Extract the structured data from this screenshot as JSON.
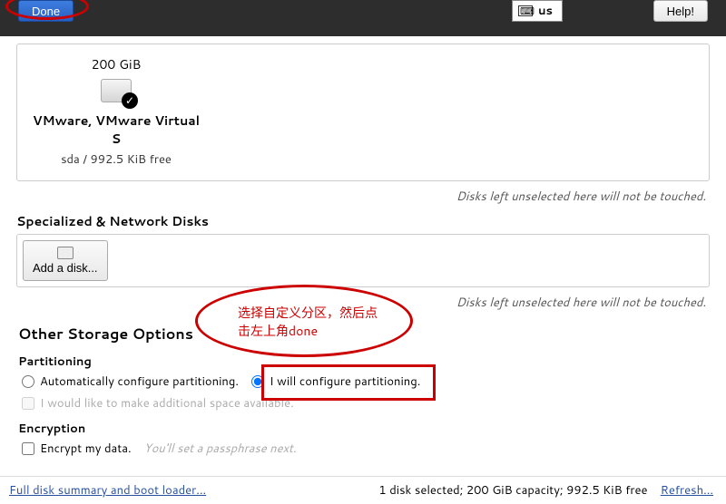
{
  "topbar": {
    "done_label": "Done",
    "lang_code": "us",
    "help_label": "Help!"
  },
  "disks": {
    "size": "200 GiB",
    "name": "VMware, VMware Virtual S",
    "detail": "sda   /   992.5 KiB free"
  },
  "notice_text": "Disks left unselected here will not be touched.",
  "specialized_title": "Specialized & Network Disks",
  "add_disk_label": "Add a disk...",
  "other_title": "Other Storage Options",
  "partitioning": {
    "header": "Partitioning",
    "auto_label": "Automatically configure partitioning.",
    "manual_label": "I will configure partitioning.",
    "additional_label": "I would like to make additional space available."
  },
  "encryption": {
    "header": "Encryption",
    "encrypt_label": "Encrypt my data.",
    "hint": "You'll set a passphrase next."
  },
  "annotation": "选择自定义分区，然后点击左上角done",
  "bottom": {
    "summary_link": "Full disk summary and boot loader...",
    "status": "1 disk selected; 200 GiB capacity; 992.5 KiB free",
    "refresh": "Refresh..."
  }
}
